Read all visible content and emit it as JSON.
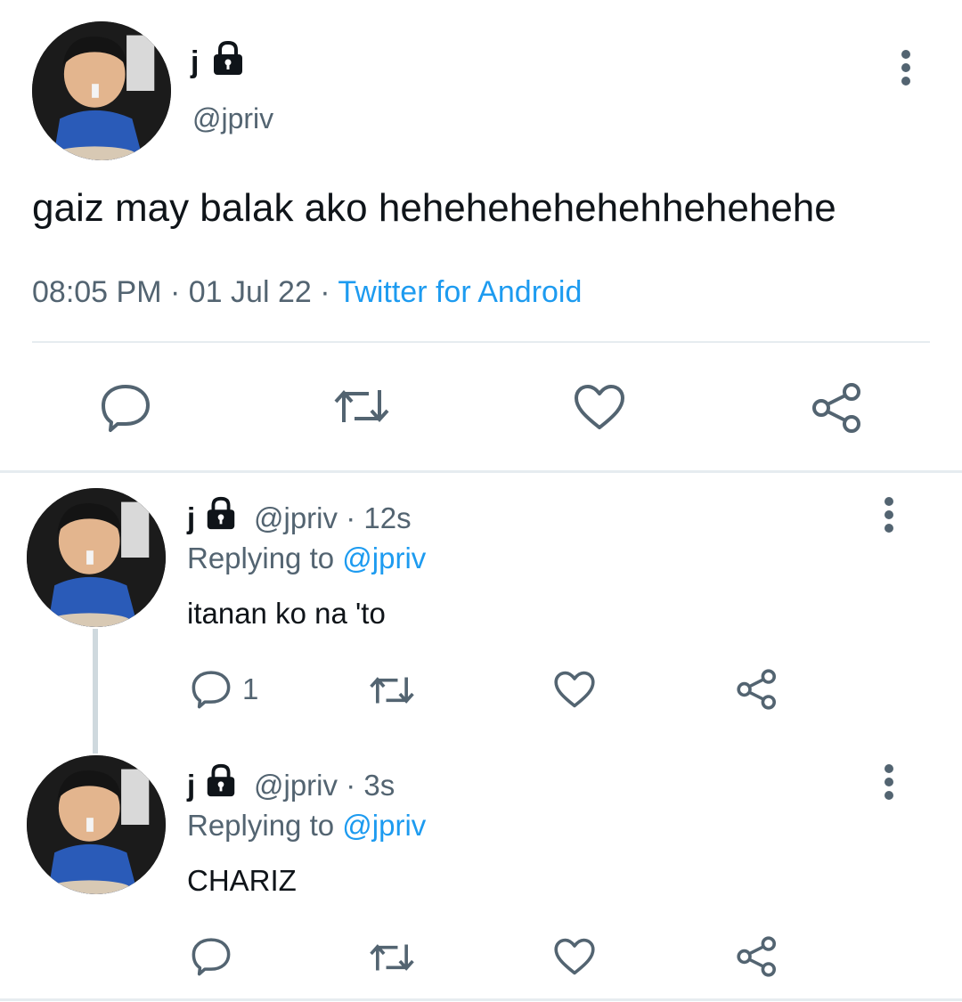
{
  "main_tweet": {
    "display_name": "j",
    "handle": "@jpriv",
    "text": "gaiz may balak ako hehehehehehehhehehehe",
    "time": "08:05 PM",
    "separator": "·",
    "date": "01 Jul 22",
    "source": "Twitter for Android",
    "icons": [
      "lock-icon",
      "more-options-icon",
      "reply-icon",
      "retweet-icon",
      "like-icon",
      "share-icon"
    ]
  },
  "replies": [
    {
      "display_name": "j",
      "handle": "@jpriv",
      "dot": "·",
      "time": "12s",
      "replying_label": "Replying to",
      "replying_handle": "@jpriv",
      "text": "itanan ko na 'to",
      "reply_count": "1"
    },
    {
      "display_name": "j",
      "handle": "@jpriv",
      "dot": "·",
      "time": "3s",
      "replying_label": "Replying to",
      "replying_handle": "@jpriv",
      "text": "CHARIZ",
      "reply_count": ""
    }
  ],
  "colors": {
    "text": "#0f1419",
    "secondary": "#536471",
    "link": "#1d9bf0",
    "divider": "#e6ecf0",
    "thread_line": "#cfd9de"
  }
}
